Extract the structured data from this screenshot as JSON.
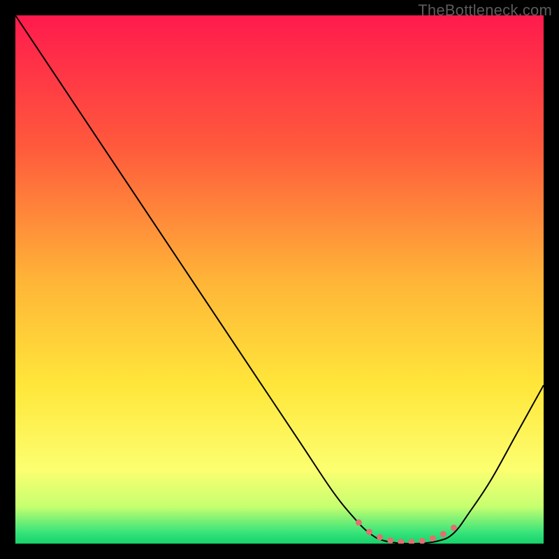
{
  "watermark": "TheBottleneck.com",
  "chart_data": {
    "type": "line",
    "title": "",
    "xlabel": "",
    "ylabel": "",
    "x_range_pct": [
      0,
      100
    ],
    "y_range_pct": [
      0,
      100
    ],
    "background_gradient": {
      "direction": "vertical",
      "stops": [
        {
          "pos": 0.0,
          "color": "#ff1a4d"
        },
        {
          "pos": 0.25,
          "color": "#ff5a3c"
        },
        {
          "pos": 0.5,
          "color": "#ffb438"
        },
        {
          "pos": 0.7,
          "color": "#ffe63a"
        },
        {
          "pos": 0.86,
          "color": "#fcff70"
        },
        {
          "pos": 0.93,
          "color": "#c6ff70"
        },
        {
          "pos": 0.98,
          "color": "#34e37a"
        },
        {
          "pos": 1.0,
          "color": "#18d06a"
        }
      ]
    },
    "series": [
      {
        "name": "bottleneck-curve",
        "stroke": "#000000",
        "stroke_width": 2,
        "points_xy_pct": [
          [
            0.0,
            100.0
          ],
          [
            4.0,
            94.0
          ],
          [
            8.0,
            88.0
          ],
          [
            14.0,
            79.0
          ],
          [
            22.0,
            67.0
          ],
          [
            30.0,
            55.0
          ],
          [
            38.0,
            43.0
          ],
          [
            46.0,
            31.0
          ],
          [
            54.0,
            19.0
          ],
          [
            60.0,
            10.0
          ],
          [
            64.0,
            5.0
          ],
          [
            67.0,
            2.0
          ],
          [
            70.0,
            0.5
          ],
          [
            75.0,
            0.0
          ],
          [
            80.0,
            0.5
          ],
          [
            83.0,
            2.0
          ],
          [
            86.0,
            6.0
          ],
          [
            90.0,
            12.0
          ],
          [
            95.0,
            21.0
          ],
          [
            100.0,
            30.0
          ]
        ]
      },
      {
        "name": "optimal-range-marker",
        "stroke": "#e07070",
        "stroke_width": 9,
        "style": "dotted",
        "points_xy_pct": [
          [
            65.0,
            4.0
          ],
          [
            67.0,
            2.2
          ],
          [
            69.0,
            1.2
          ],
          [
            71.0,
            0.6
          ],
          [
            73.0,
            0.3
          ],
          [
            75.0,
            0.3
          ],
          [
            77.0,
            0.5
          ],
          [
            79.0,
            1.0
          ],
          [
            81.0,
            1.8
          ],
          [
            83.0,
            3.0
          ]
        ]
      }
    ],
    "optimal_x_range_pct": [
      65,
      83
    ]
  }
}
